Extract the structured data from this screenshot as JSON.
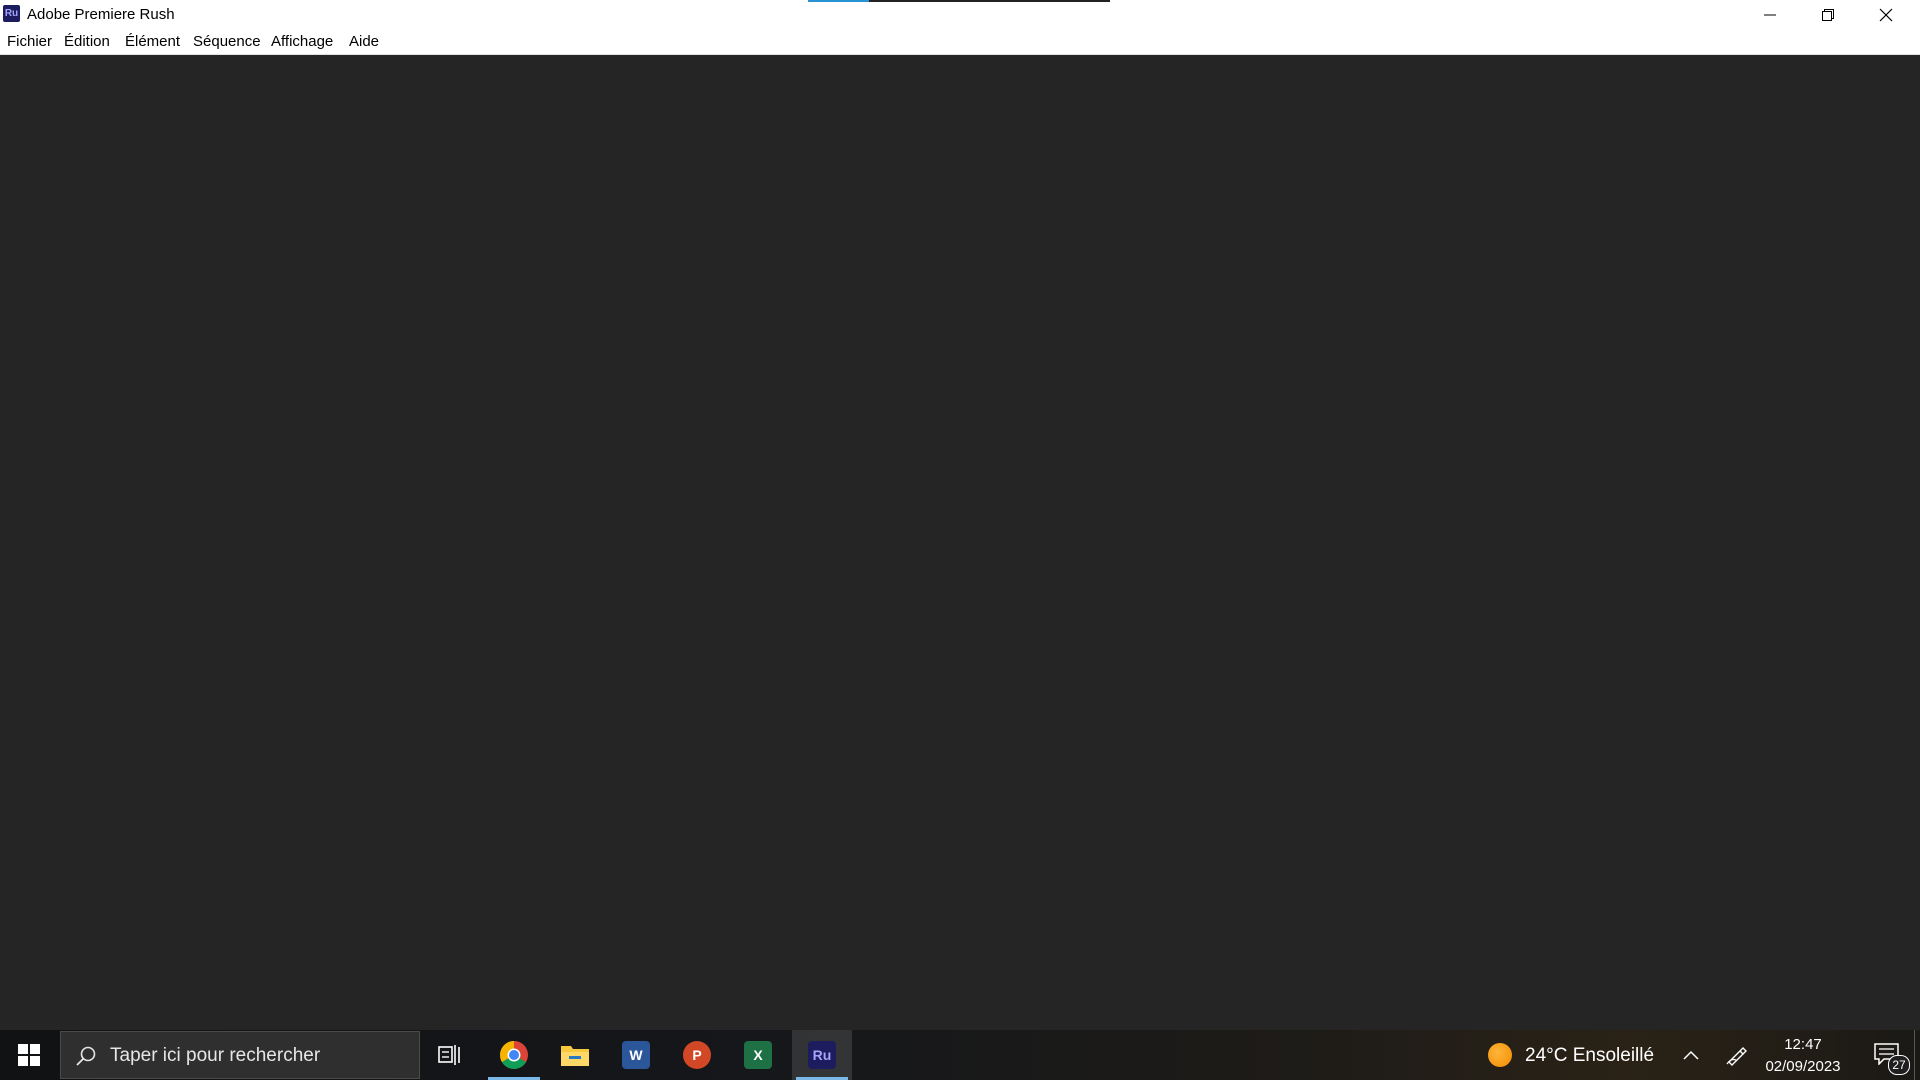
{
  "window": {
    "title": "Adobe Premiere Rush",
    "app_icon_label": "Ru",
    "controls": [
      "minimize-icon",
      "restore-icon",
      "close-icon"
    ]
  },
  "menu": {
    "items": [
      {
        "label": "Fichier"
      },
      {
        "label": "Édition"
      },
      {
        "label": "Élément"
      },
      {
        "label": "Séquence"
      },
      {
        "label": "Affichage"
      },
      {
        "label": "Aide"
      }
    ]
  },
  "taskbar": {
    "search_placeholder": "Taper ici pour rechercher",
    "apps": [
      {
        "name": "Chrome",
        "icon": "chrome-icon",
        "active": false,
        "running": true
      },
      {
        "name": "File Explorer",
        "icon": "folder-icon",
        "active": false,
        "running": false
      },
      {
        "name": "Word",
        "icon": "word-icon",
        "label": "W",
        "color": "#2b579a",
        "active": false,
        "running": false
      },
      {
        "name": "PowerPoint",
        "icon": "powerpoint-icon",
        "label": "P",
        "color": "#d24726",
        "active": false,
        "running": false
      },
      {
        "name": "Excel",
        "icon": "excel-icon",
        "label": "X",
        "color": "#1e7145",
        "active": false,
        "running": false
      },
      {
        "name": "Premiere Rush",
        "icon": "premiere-rush-icon",
        "label": "Ru",
        "color": "#1c1c5e",
        "active": true,
        "running": true
      }
    ],
    "weather": {
      "text": "24°C  Ensoleillé",
      "icon": "sun-icon"
    },
    "clock": {
      "time": "12:47",
      "date": "02/09/2023"
    },
    "notifications": {
      "count": "27"
    }
  },
  "colors": {
    "content_bg": "#252525",
    "titlebar_bg": "#ffffff",
    "accent": "#7ab8e8"
  }
}
